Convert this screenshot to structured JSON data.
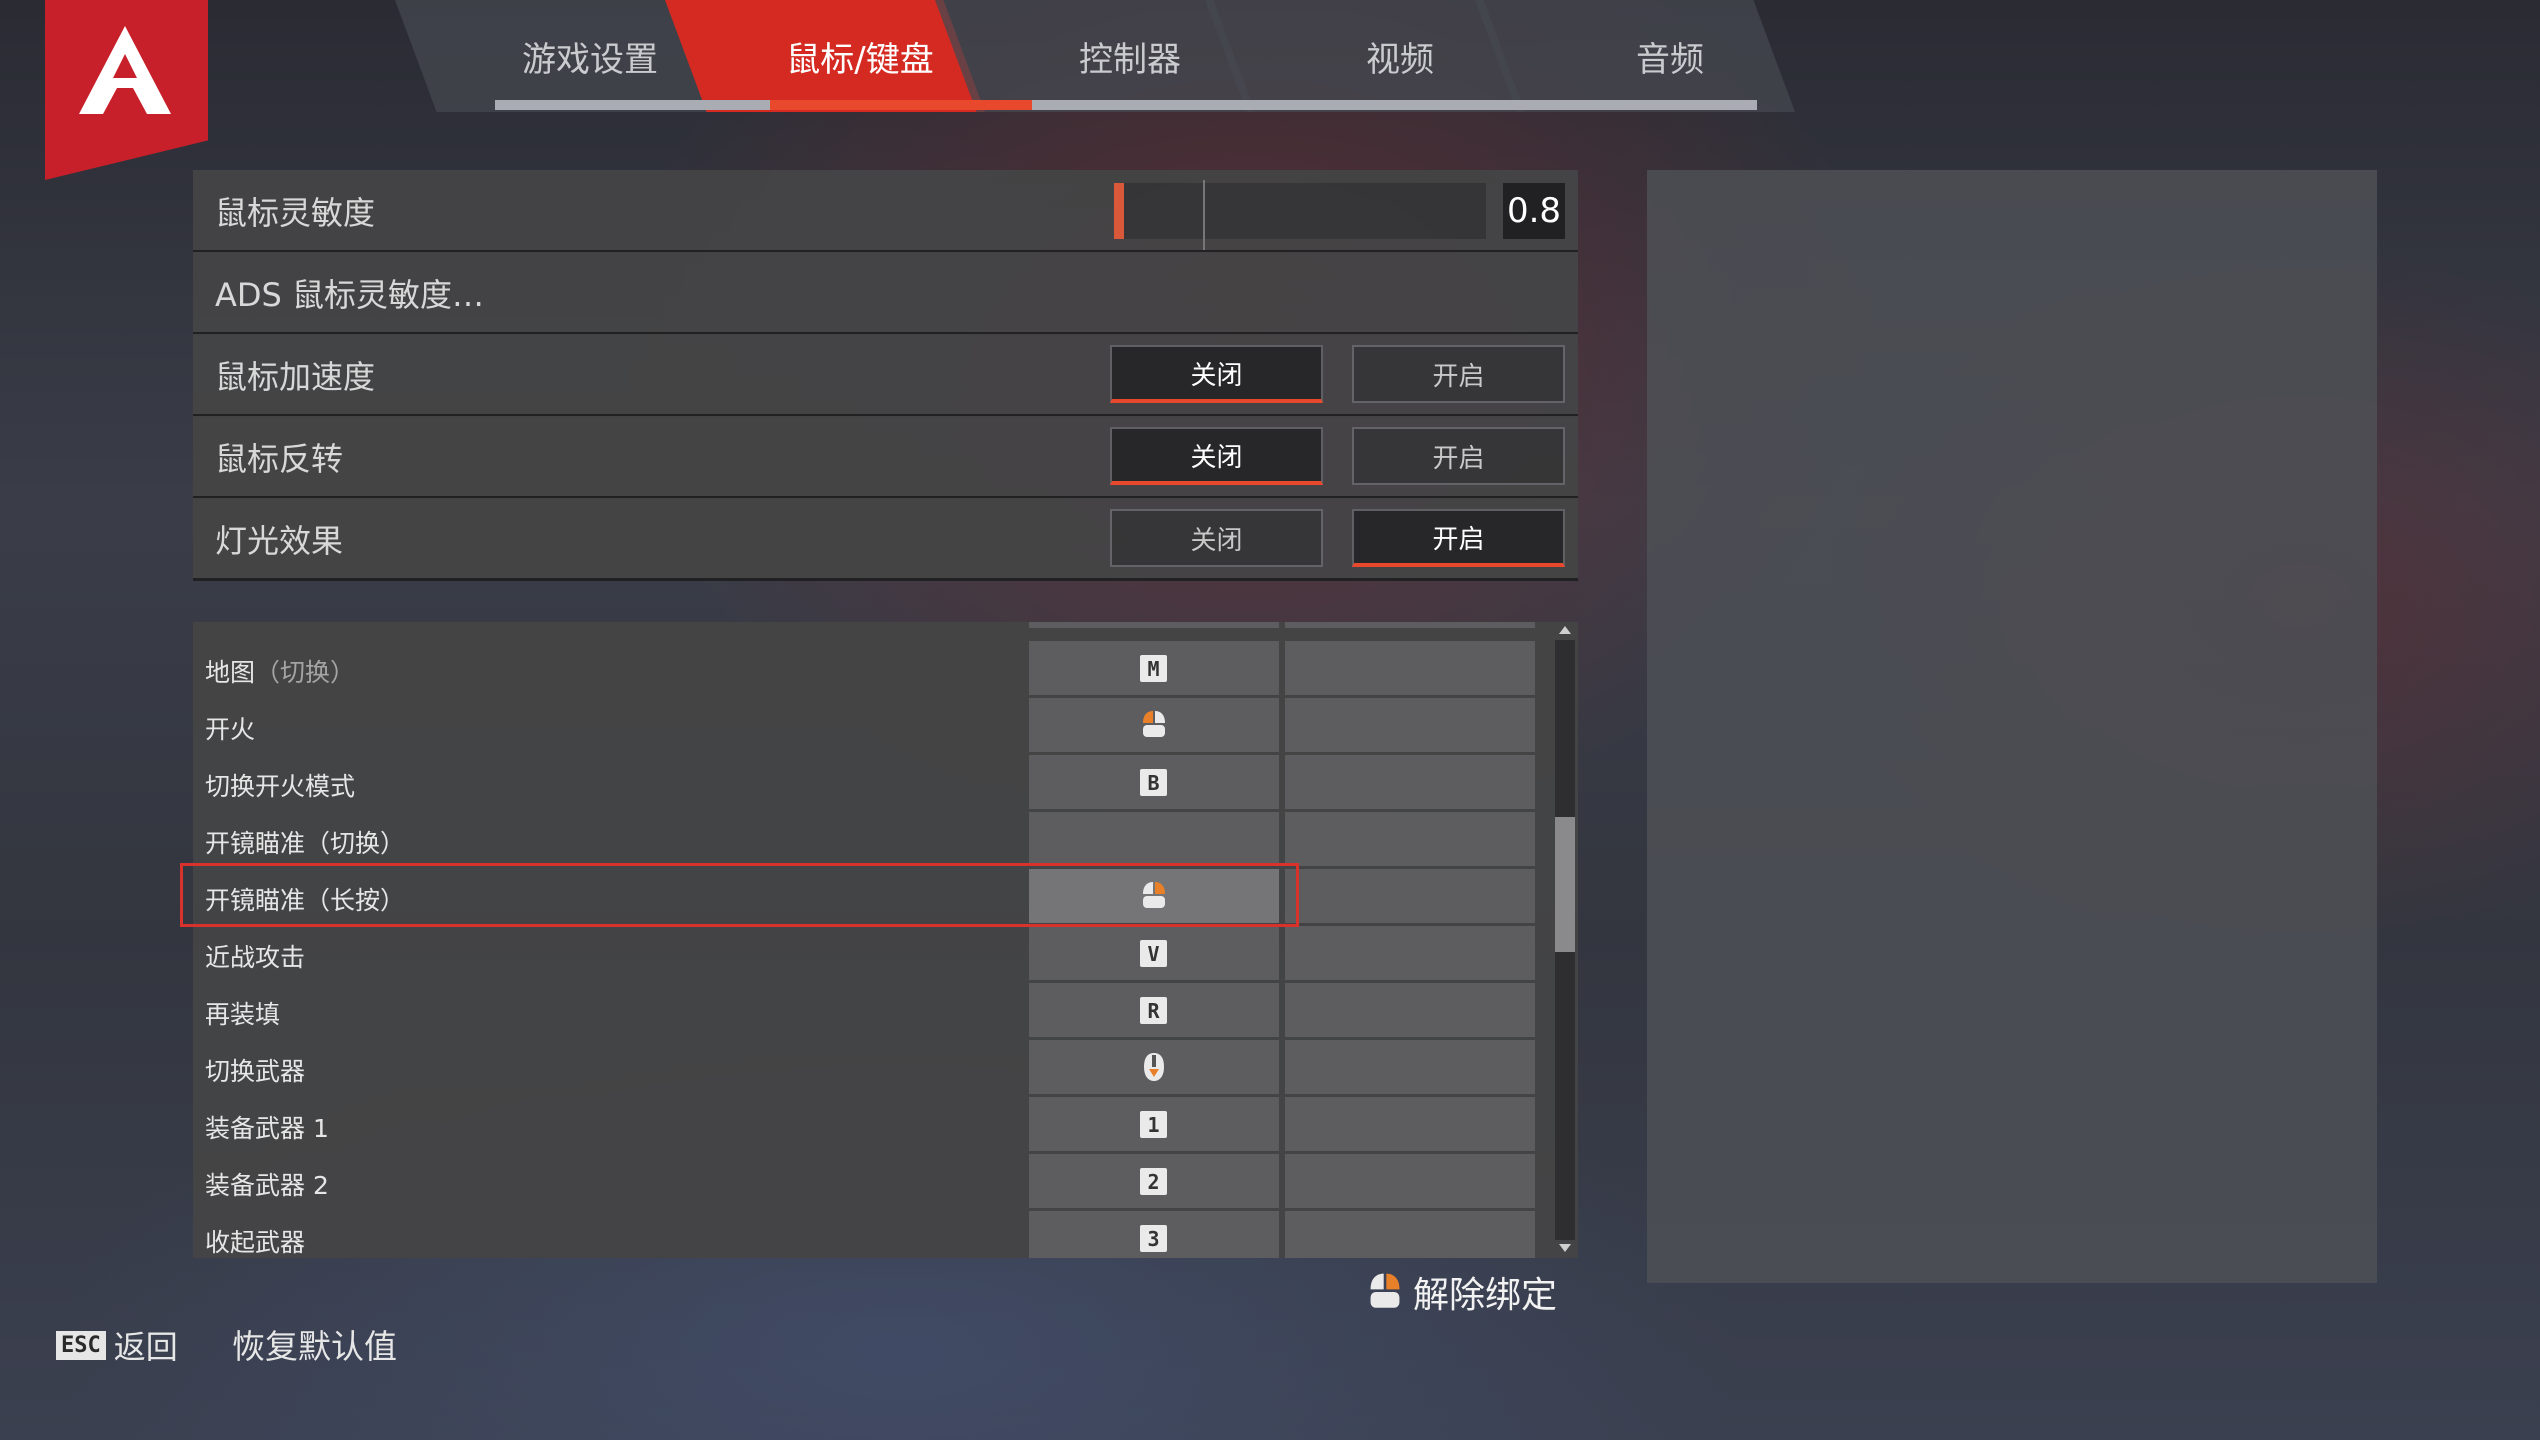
{
  "nav": {
    "tabs": [
      {
        "label": "游戏设置",
        "active": false
      },
      {
        "label": "鼠标/键盘",
        "active": true
      },
      {
        "label": "控制器",
        "active": false
      },
      {
        "label": "视频",
        "active": false
      },
      {
        "label": "音频",
        "active": false
      }
    ],
    "accent": "#e8492c"
  },
  "settings": {
    "sensitivity": {
      "label": "鼠标灵敏度",
      "value": "0.8"
    },
    "ads": {
      "label": "ADS 鼠标灵敏度…"
    },
    "acceleration": {
      "label": "鼠标加速度",
      "off": "关闭",
      "on": "开启",
      "selected": "off"
    },
    "invert": {
      "label": "鼠标反转",
      "off": "关闭",
      "on": "开启",
      "selected": "off"
    },
    "lighting": {
      "label": "灯光效果",
      "off": "关闭",
      "on": "开启",
      "selected": "on"
    }
  },
  "bindings": [
    {
      "name": "地图",
      "sub": "（切换）",
      "key1": "M",
      "key1_type": "key"
    },
    {
      "name": "开火",
      "sub": "",
      "key1": "mouse-left-icon",
      "key1_type": "mouse"
    },
    {
      "name": "切换开火模式",
      "sub": "",
      "key1": "B",
      "key1_type": "key"
    },
    {
      "name": "开镜瞄准（切换）",
      "sub": "",
      "key1": "",
      "key1_type": "none"
    },
    {
      "name": "开镜瞄准（长按）",
      "sub": "",
      "key1": "mouse-right-icon",
      "key1_type": "mouse",
      "highlighted": true
    },
    {
      "name": "近战攻击",
      "sub": "",
      "key1": "V",
      "key1_type": "key"
    },
    {
      "name": "再装填",
      "sub": "",
      "key1": "R",
      "key1_type": "key"
    },
    {
      "name": "切换武器",
      "sub": "",
      "key1": "mouse-wheel-down-icon",
      "key1_type": "wheel"
    },
    {
      "name": "装备武器 1",
      "sub": "",
      "key1": "1",
      "key1_type": "key"
    },
    {
      "name": "装备武器 2",
      "sub": "",
      "key1": "2",
      "key1_type": "key"
    },
    {
      "name": "收起武器",
      "sub": "",
      "key1": "3",
      "key1_type": "key"
    }
  ],
  "footer": {
    "unbind_label": "解除绑定",
    "esc_key": "ESC",
    "back_label": "返回",
    "restore_label": "恢复默认值"
  }
}
